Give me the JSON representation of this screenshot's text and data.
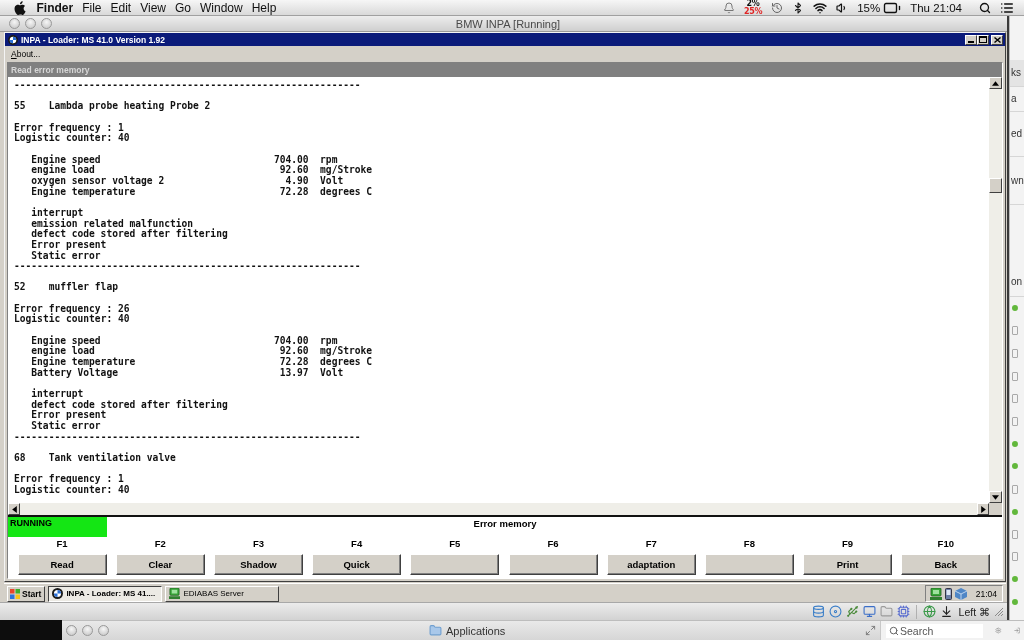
{
  "menu_bar": {
    "app_name": "Finder",
    "menus": [
      "File",
      "Edit",
      "View",
      "Go",
      "Window",
      "Help"
    ],
    "cpu_usage": [
      {
        "value": "2%",
        "color": "#111111"
      },
      {
        "value": "25%",
        "color": "#e02424"
      }
    ],
    "battery": "15%",
    "clock": "Thu 21:04"
  },
  "vm_window": {
    "title": "BMW INPA [Running]",
    "keyboard": "Left ⌘"
  },
  "inpa_window": {
    "title": "INPA - Loader: MS 41.0 Version 1.92",
    "menus": [
      "About..."
    ],
    "panel_title": "Read error memory",
    "errors": [
      {
        "separator": "------------------------------------------------------------",
        "code": "55",
        "name": "Lambda probe heating Probe 2",
        "frequency": "Error frequency : 1",
        "counter": "Logistic counter: 40",
        "conditions": [
          {
            "name": "Engine speed",
            "value": "704.00",
            "unit": "rpm"
          },
          {
            "name": "engine load",
            "value": "92.60",
            "unit": "mg/Stroke"
          },
          {
            "name": "oxygen sensor voltage 2",
            "value": "4.90",
            "unit": "Volt"
          },
          {
            "name": "Engine temperature",
            "value": "72.28",
            "unit": "degrees C"
          }
        ],
        "flags": [
          "interrupt",
          "emission related malfunction",
          "defect code stored after filtering",
          "Error present",
          "Static error"
        ]
      },
      {
        "separator": "------------------------------------------------------------",
        "code": "52",
        "name": "muffler flap",
        "frequency": "Error frequency : 26",
        "counter": "Logistic counter: 40",
        "conditions": [
          {
            "name": "Engine speed",
            "value": "704.00",
            "unit": "rpm"
          },
          {
            "name": "engine load",
            "value": "92.60",
            "unit": "mg/Stroke"
          },
          {
            "name": "Engine temperature",
            "value": "72.28",
            "unit": "degrees C"
          },
          {
            "name": "Battery Voltage",
            "value": "13.97",
            "unit": "Volt"
          }
        ],
        "flags": [
          "interrupt",
          "defect code stored after filtering",
          "Error present",
          "Static error"
        ]
      },
      {
        "separator": "------------------------------------------------------------",
        "code": "68",
        "name": "Tank ventilation valve",
        "frequency": "Error frequency : 1",
        "counter": "Logistic counter: 40"
      }
    ],
    "status": "RUNNING",
    "screen_title": "Error memory",
    "function_keys": [
      {
        "key": "F1",
        "label": "Read"
      },
      {
        "key": "F2",
        "label": "Clear"
      },
      {
        "key": "F3",
        "label": "Shadow"
      },
      {
        "key": "F4",
        "label": "Quick"
      },
      {
        "key": "F5"
      },
      {
        "key": "F6"
      },
      {
        "key": "F7",
        "label": "adaptation"
      },
      {
        "key": "F8"
      },
      {
        "key": "F9",
        "label": "Print"
      },
      {
        "key": "F10",
        "label": "Back"
      }
    ]
  },
  "taskbar": {
    "start": "Start",
    "tasks": [
      {
        "kind": "roundel",
        "label": "INPA - Loader: MS 41....",
        "selected": true
      },
      {
        "kind": "server",
        "label": "EDIABAS Server",
        "selected": false
      }
    ],
    "clock": "21:04"
  },
  "finder_window": {
    "title": "Applications",
    "search": {
      "placeholder": "Search"
    }
  },
  "background_window": {
    "fragments": [
      "ks",
      "a",
      "ed",
      "wn",
      "on"
    ]
  }
}
